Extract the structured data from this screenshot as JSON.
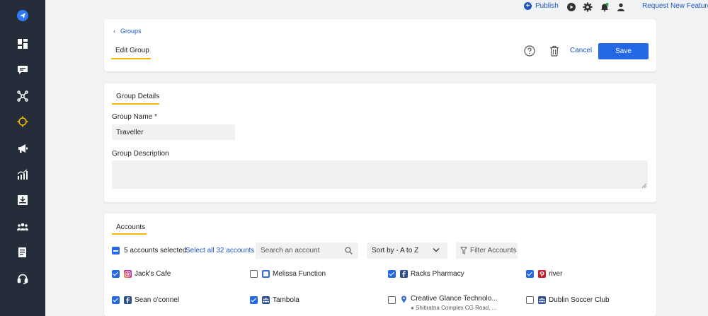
{
  "colors": {
    "accent": "#2468e6",
    "link": "#1f55c7",
    "sidebar": "#252d3a",
    "highlight": "#f5b800"
  },
  "topbar": {
    "publish_label": "Publish",
    "request_label": "Request New Feature"
  },
  "header": {
    "breadcrumb": "Groups",
    "title": "Edit Group",
    "cancel_label": "Cancel",
    "save_label": "Save"
  },
  "details": {
    "section_title": "Group Details",
    "name_label": "Group Name *",
    "name_value": "Traveller",
    "description_label": "Group Description",
    "description_value": ""
  },
  "accounts": {
    "section_title": "Accounts",
    "selected_text": "5 accounts selected.",
    "select_all_label": "Select all 32 accounts",
    "search_placeholder": "Search an account",
    "sort_label": "Sort by - A to Z",
    "filter_label": "Filter Accounts",
    "items": [
      {
        "name": "Jack's Cafe",
        "checked": true,
        "icon": "instagram-icon"
      },
      {
        "name": "Melissa Function",
        "checked": false,
        "icon": "gmb-icon"
      },
      {
        "name": "Racks Pharmacy",
        "checked": true,
        "icon": "facebook-icon"
      },
      {
        "name": "river",
        "checked": true,
        "icon": "pinterest-icon"
      },
      {
        "name": "Sean o'connel",
        "checked": true,
        "icon": "facebook-icon"
      },
      {
        "name": "Tambola",
        "checked": true,
        "icon": "group-icon"
      },
      {
        "name": "Creative Glance Technolo...",
        "sub": "Shitiratna Complex CG Road, ...",
        "checked": false,
        "icon": "location-icon"
      },
      {
        "name": "Dublin Soccer Club",
        "checked": false,
        "icon": "group-icon"
      }
    ]
  }
}
